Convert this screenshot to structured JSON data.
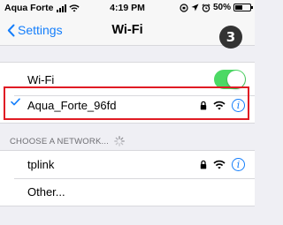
{
  "status_bar": {
    "carrier": "Aqua Forte",
    "time": "4:19 PM",
    "battery": "50%",
    "battery_level": 0.5
  },
  "nav": {
    "back_label": "Settings",
    "title": "Wi-Fi"
  },
  "step_badge": "3",
  "wifi_toggle": {
    "label": "Wi-Fi",
    "on": true,
    "color": "#4cd964"
  },
  "connected_network": {
    "name": "Aqua_Forte_96fd",
    "locked": true,
    "highlight_color": "#e01b24"
  },
  "networks_section": {
    "header": "CHOOSE A NETWORK...",
    "items": [
      {
        "name": "tplink",
        "locked": true
      },
      {
        "name": "Other..."
      }
    ]
  },
  "colors": {
    "accent": "#147efb",
    "background": "#efeff4"
  }
}
